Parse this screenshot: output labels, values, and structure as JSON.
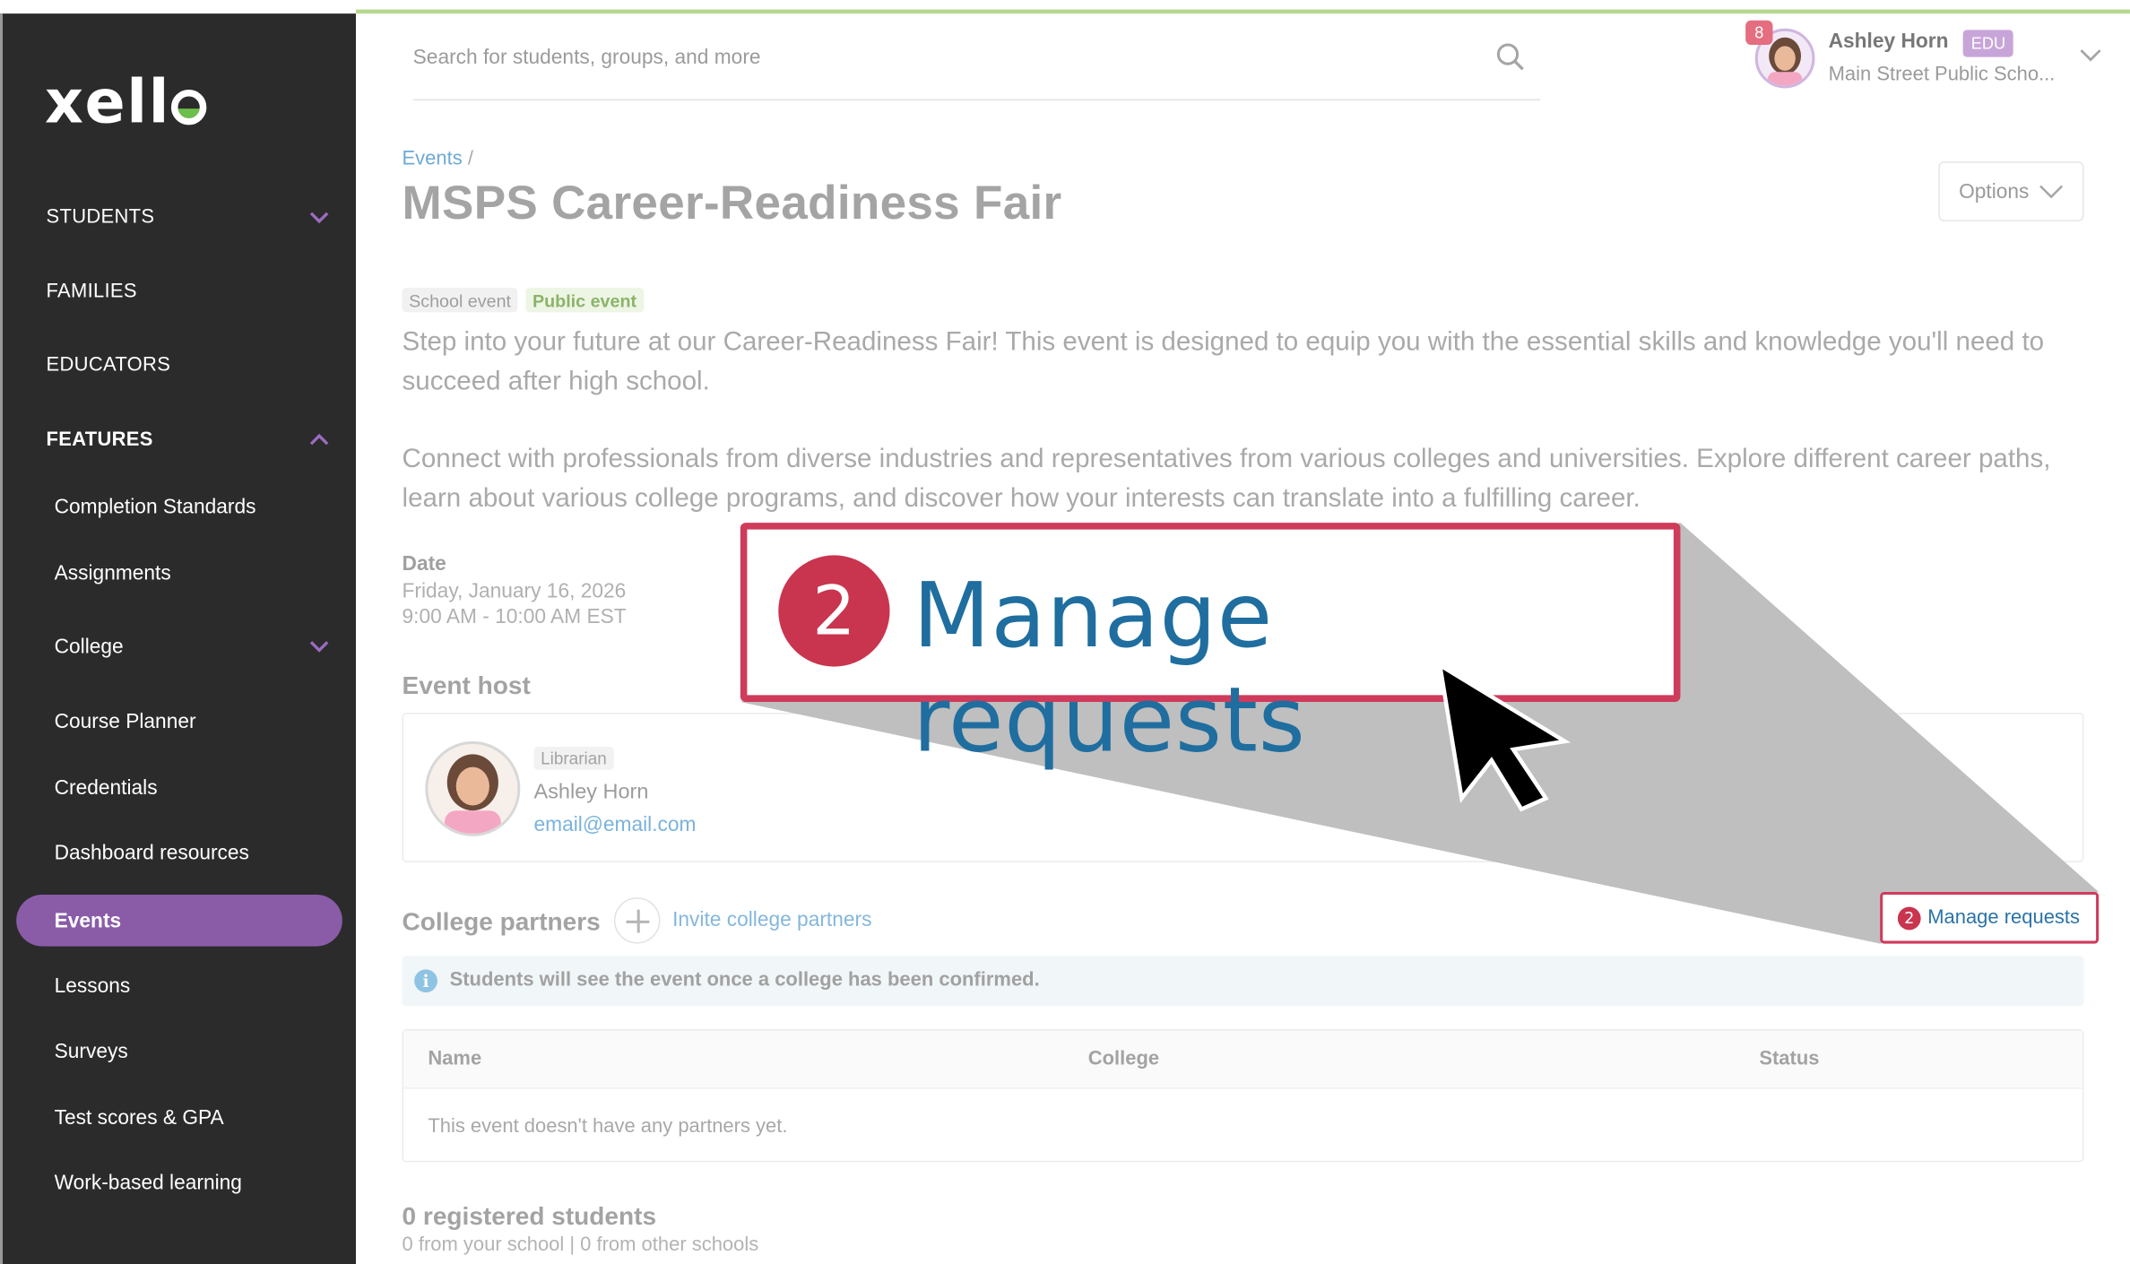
{
  "app": {
    "logo": "xello"
  },
  "sidebar": {
    "students": "STUDENTS",
    "families": "FAMILIES",
    "educators": "EDUCATORS",
    "features": "FEATURES",
    "items": [
      {
        "label": "Completion Standards"
      },
      {
        "label": "Assignments"
      },
      {
        "label": "College"
      },
      {
        "label": "Course Planner"
      },
      {
        "label": "Credentials"
      },
      {
        "label": "Dashboard resources"
      },
      {
        "label": "Events"
      },
      {
        "label": "Lessons"
      },
      {
        "label": "Surveys"
      },
      {
        "label": "Test scores & GPA"
      },
      {
        "label": "Work-based learning"
      }
    ]
  },
  "header": {
    "search_placeholder": "Search for students, groups, and more",
    "notifications": "8",
    "user_name": "Ashley Horn",
    "role_badge": "EDU",
    "school": "Main Street Public Scho..."
  },
  "page": {
    "breadcrumb": "Events",
    "breadcrumb_sep": "/",
    "title": "MSPS Career-Readiness Fair",
    "options": "Options",
    "tags": {
      "school": "School event",
      "public": "Public event"
    },
    "desc1": "Step into your future at our Career-Readiness Fair! This event is designed to equip you with the essential skills and knowledge you'll need to succeed after high school.",
    "desc2": "Connect with professionals from diverse industries and representatives from various colleges and universities. Explore different career paths, learn about various college programs, and discover how your interests can translate into a fulfilling career.",
    "date_label": "Date",
    "date": "Friday, January 16, 2026",
    "time": "9:00 AM - 10:00 AM EST",
    "host_heading": "Event host",
    "host": {
      "role": "Librarian",
      "name": "Ashley Horn",
      "email": "email@email.com"
    },
    "partners_heading": "College partners",
    "invite": "Invite college partners",
    "manage_requests": "Manage requests",
    "info": "Students will see the event once a college has been confirmed.",
    "table": {
      "headers": [
        "Name",
        "College",
        "Status"
      ],
      "empty": "This event doesn't have any partners yet."
    },
    "registered": "0 registered students",
    "registered_sub": "0 from your school | 0 from other schools"
  },
  "callout": {
    "step": "2",
    "text": "Manage requests"
  },
  "colors": {
    "accent": "#8a5ca8",
    "callout": "#cf3b5b",
    "link": "#2b73a7"
  }
}
